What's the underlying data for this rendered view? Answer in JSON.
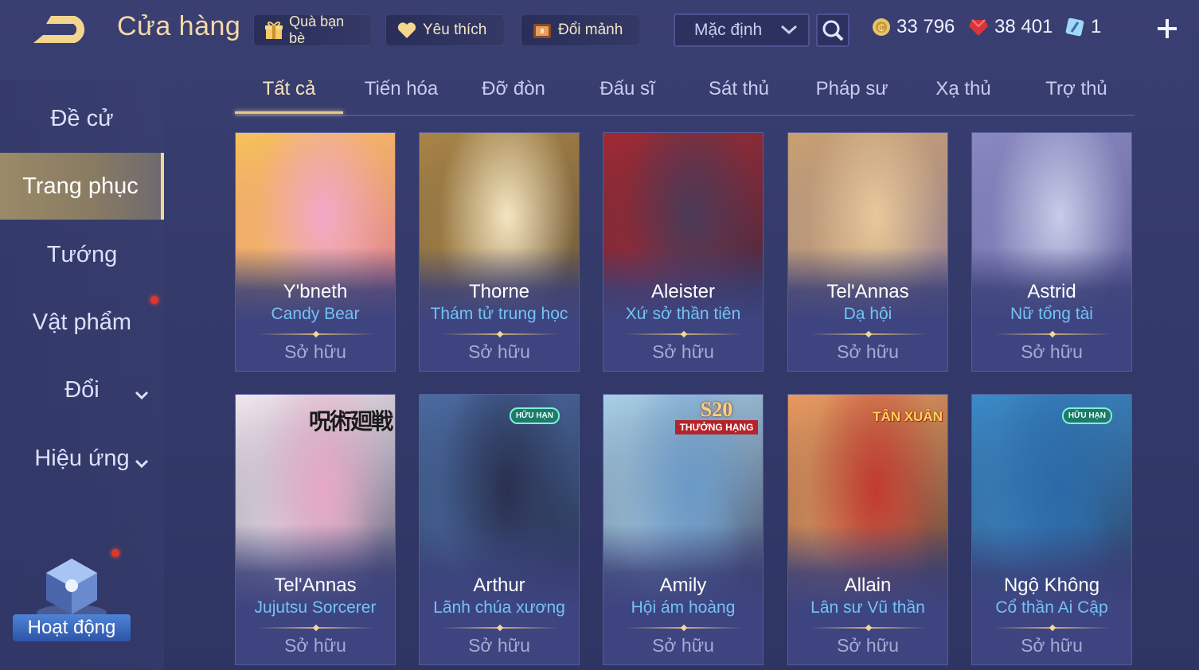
{
  "header": {
    "title": "Cửa hàng",
    "gift_label": "Quà bạn bè",
    "favorite_label": "Yêu thích",
    "exchange_label": "Đổi mảnh",
    "sort_value": "Mặc định",
    "gold": "33 796",
    "vouchers": "38 401",
    "gems": "1"
  },
  "tabs": [
    "Tất cả",
    "Tiến hóa",
    "Đỡ đòn",
    "Đấu sĩ",
    "Sát thủ",
    "Pháp sư",
    "Xạ thủ",
    "Trợ thủ"
  ],
  "sidebar": {
    "items": [
      "Đề cử",
      "Trang phục",
      "Tướng",
      "Vật phẩm",
      "Đổi",
      "Hiệu ứng"
    ],
    "activity_label": "Hoạt động"
  },
  "cards": [
    {
      "hero": "Y'bneth",
      "skin": "Candy Bear",
      "status": "Sở hữu",
      "colors": [
        "#f2a8c8",
        "#f7c15a",
        "#d86aa4"
      ]
    },
    {
      "hero": "Thorne",
      "skin": "Thám tử trung học",
      "status": "Sở hữu",
      "colors": [
        "#f4e6c2",
        "#a88446",
        "#5a4a38"
      ]
    },
    {
      "hero": "Aleister",
      "skin": "Xứ sở thần tiên",
      "status": "Sở hữu",
      "colors": [
        "#4a3a58",
        "#a02a34",
        "#2a2a44"
      ]
    },
    {
      "hero": "Tel'Annas",
      "skin": "Dạ hội",
      "status": "Sở hữu",
      "colors": [
        "#e8c89a",
        "#c8a070",
        "#8a7aa0"
      ]
    },
    {
      "hero": "Astrid",
      "skin": "Nữ tổng tài",
      "status": "Sở hữu",
      "colors": [
        "#c8cce8",
        "#8a88c0",
        "#5a5a94"
      ]
    },
    {
      "hero": "Tel'Annas",
      "skin": "Jujutsu Sorcerer",
      "status": "Sở hữu",
      "colors": [
        "#e6a8c4",
        "#f2e6ee",
        "#3a3a5a"
      ],
      "badge_text": "呪術廻戦"
    },
    {
      "hero": "Arthur",
      "skin": "Lãnh chúa xương",
      "status": "Sở hữu",
      "colors": [
        "#2a3050",
        "#4a6aa0",
        "#1e2238"
      ],
      "badge_text": "HỮU HẠN"
    },
    {
      "hero": "Amily",
      "skin": "Hội ám hoàng",
      "status": "Sở hữu",
      "colors": [
        "#6a9ac8",
        "#a8d0e8",
        "#2a2a48"
      ],
      "badge_text": "S20",
      "badge_sub": "THƯỞNG HẠNG"
    },
    {
      "hero": "Allain",
      "skin": "Lân sư Vũ thần",
      "status": "Sở hữu",
      "colors": [
        "#c23a30",
        "#e89a60",
        "#3a2a30"
      ],
      "badge_text": "TÂN XUÂN"
    },
    {
      "hero": "Ngộ Không",
      "skin": "Cổ thần Ai Cập",
      "status": "Sở hữu",
      "colors": [
        "#2a6aa8",
        "#3a8ac8",
        "#2a3050"
      ],
      "badge_text": "HỮU HẠN"
    }
  ],
  "colors": {
    "accent_gold": "#f0d79a",
    "skin_blue": "#74c2f4",
    "background": "#343a6a"
  }
}
